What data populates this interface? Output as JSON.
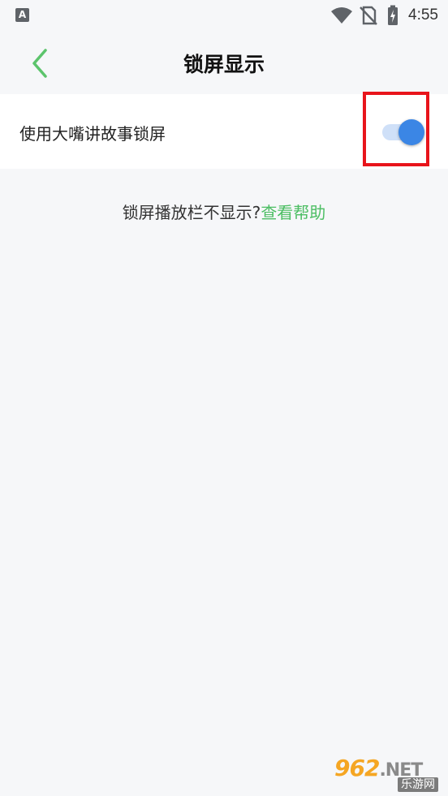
{
  "status": {
    "notification_icon": "text-a-icon",
    "notification_letter": "A",
    "icons": [
      "wifi-icon",
      "no-sim-icon",
      "battery-charging-icon"
    ],
    "time": "4:55"
  },
  "header": {
    "back_icon": "chevron-left-icon",
    "title": "锁屏显示"
  },
  "settings": {
    "lockscreen_label": "使用大嘴讲故事锁屏",
    "lockscreen_enabled": true
  },
  "help": {
    "question": "锁屏播放栏不显示?",
    "link": "查看帮助"
  },
  "watermark": {
    "brand_number": "962",
    "brand_suffix": ".NET",
    "brand_cn": "乐游网"
  },
  "colors": {
    "accent_green": "#4cbe63",
    "toggle_on": "#3b86e5",
    "highlight_red": "#e8141b",
    "background": "#f6f7f9"
  }
}
